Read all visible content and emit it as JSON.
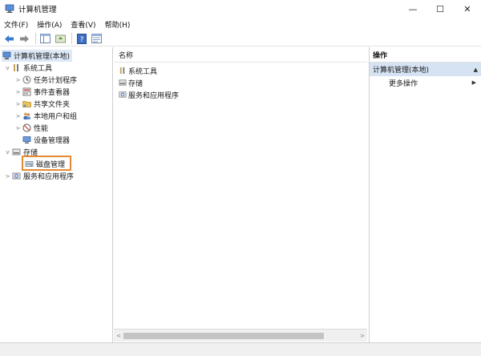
{
  "window": {
    "title": "计算机管理",
    "minimize": "—",
    "maximize": "☐",
    "close": "✕"
  },
  "menu": [
    "文件(F)",
    "操作(A)",
    "查看(V)",
    "帮助(H)"
  ],
  "tree": {
    "root": "计算机管理(本地)",
    "system_tools": "系统工具",
    "task_scheduler": "任务计划程序",
    "event_viewer": "事件查看器",
    "shared_folders": "共享文件夹",
    "local_users": "本地用户和组",
    "performance": "性能",
    "device_manager": "设备管理器",
    "storage": "存储",
    "disk_management": "磁盘管理",
    "services_apps": "服务和应用程序"
  },
  "list": {
    "column_name": "名称",
    "items": [
      "系统工具",
      "存储",
      "服务和应用程序"
    ]
  },
  "actions": {
    "header": "操作",
    "section": "计算机管理(本地)",
    "more": "更多操作"
  },
  "colors": {
    "accent": "#dde9f7",
    "highlight": "#e58a34"
  }
}
